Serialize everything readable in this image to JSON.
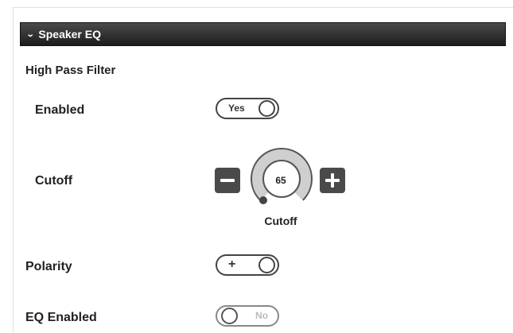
{
  "section": {
    "title": "Speaker EQ",
    "expanded": true
  },
  "high_pass_filter": {
    "heading": "High Pass Filter",
    "enabled": {
      "label": "Enabled",
      "value": "Yes",
      "on": true
    },
    "cutoff": {
      "label": "Cutoff",
      "value": "65",
      "caption": "Cutoff",
      "decrement_icon": "minus-icon",
      "increment_icon": "plus-icon"
    }
  },
  "polarity": {
    "label": "Polarity",
    "value": "+",
    "on": true
  },
  "eq_enabled": {
    "label": "EQ Enabled",
    "value": "No",
    "on": false
  },
  "colors": {
    "header_dark": "#1d1d1d",
    "button_dark": "#4a4a4a",
    "knob_ring": "#cccccc"
  }
}
